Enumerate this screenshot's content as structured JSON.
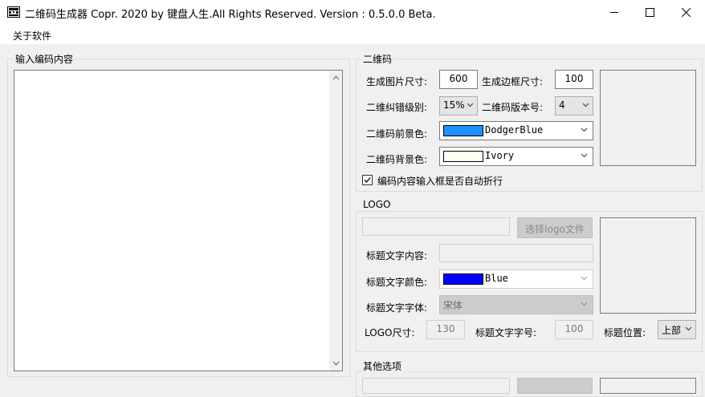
{
  "window": {
    "title": "二维码生成器  Copr. 2020 by 键盘人生.All Rights Reserved.  Version : 0.5.0.0 Beta."
  },
  "menu": {
    "about": "关于软件"
  },
  "input_group": {
    "title": "输入编码内容",
    "content": ""
  },
  "qr_group": {
    "title": "二维码",
    "size_label": "生成图片尺寸:",
    "size_value": "600",
    "border_label": "生成边框尺寸:",
    "border_value": "100",
    "ecc_label": "二维纠错级别:",
    "ecc_value": "15%",
    "version_label": "二维码版本号:",
    "version_value": "4",
    "fg_label": "二维码前景色:",
    "fg_name": "DodgerBlue",
    "fg_color": "#1e90ff",
    "bg_label": "二维码背景色:",
    "bg_name": "Ivory",
    "bg_color": "#fffff0",
    "wrap_label": "编码内容输入框是否自动折行",
    "wrap_checked": true
  },
  "logo_group": {
    "title": "LOGO",
    "path_value": "",
    "select_button": "选择logo文件",
    "caption_label": "标题文字内容:",
    "caption_value": "",
    "caption_color_label": "标题文字颜色:",
    "caption_color_name": "Blue",
    "caption_color": "#0000ff",
    "caption_font_label": "标题文字字体:",
    "caption_font_value": "宋体",
    "logo_size_label": "LOGO尺寸:",
    "logo_size_value": "130",
    "caption_size_label": "标题文字字号:",
    "caption_size_value": "100",
    "caption_pos_label": "标题位置:",
    "caption_pos_value": "上部"
  },
  "other_group": {
    "title": "其他选项"
  }
}
